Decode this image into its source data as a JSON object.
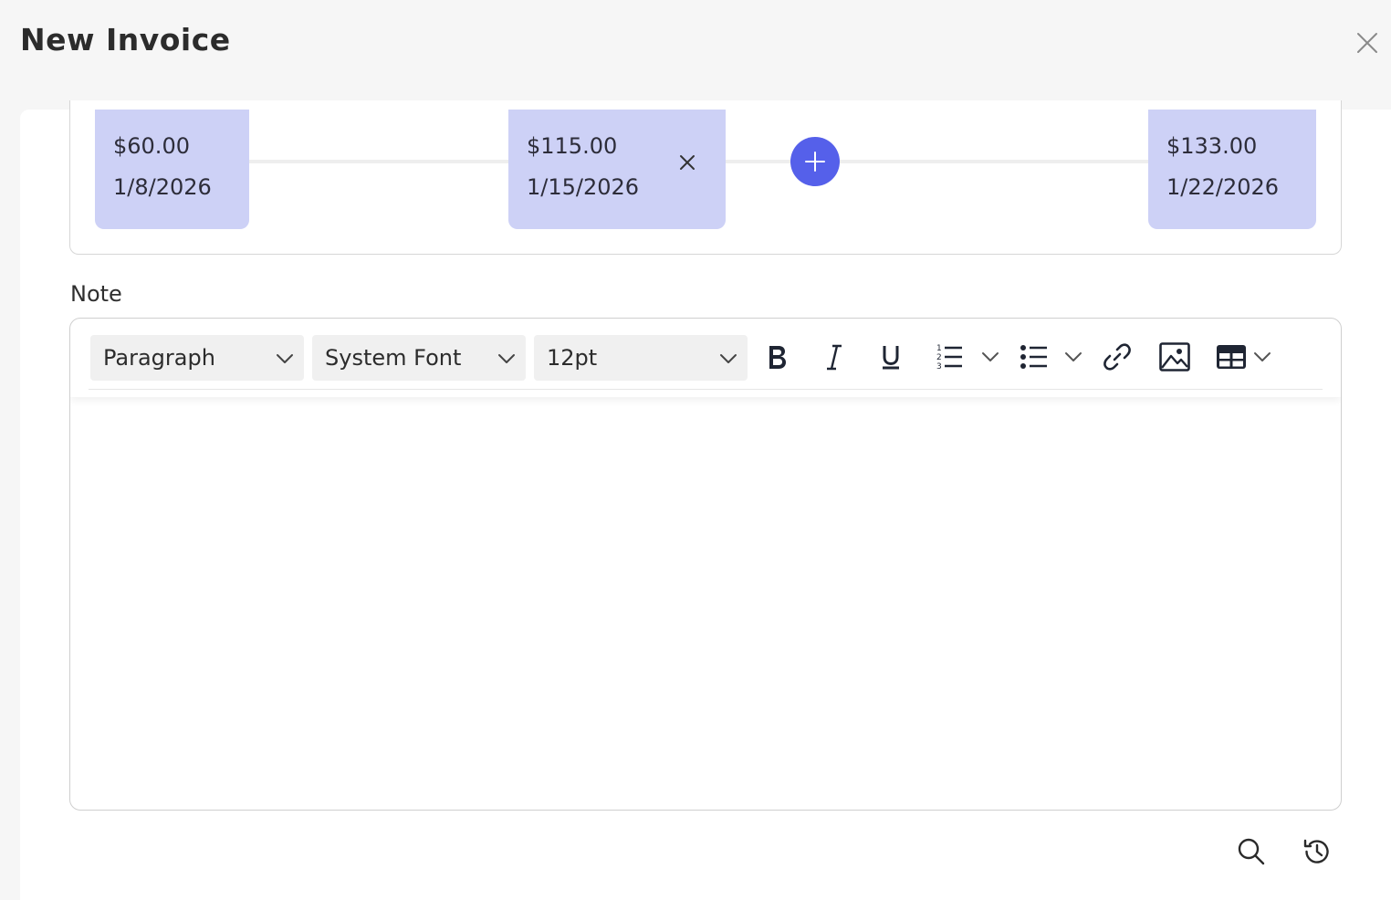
{
  "header": {
    "title": "New Invoice"
  },
  "schedule": {
    "payments": [
      {
        "amount": "$60.00",
        "date": "1/8/2026"
      },
      {
        "amount": "$115.00",
        "date": "1/15/2026"
      },
      {
        "amount": "$133.00",
        "date": "1/22/2026"
      }
    ]
  },
  "note": {
    "label": "Note",
    "toolbar": {
      "block_format": "Paragraph",
      "font_family": "System Font",
      "font_size": "12pt"
    },
    "content": ""
  },
  "colors": {
    "accent": "#5560ea",
    "card": "#cdd1f6"
  },
  "icons": [
    "close-icon",
    "remove-icon",
    "plus-icon",
    "chevron-down-icon",
    "bold-icon",
    "italic-icon",
    "underline-icon",
    "numbered-list-icon",
    "bullet-list-icon",
    "link-icon",
    "image-icon",
    "table-icon",
    "search-icon",
    "history-icon"
  ]
}
